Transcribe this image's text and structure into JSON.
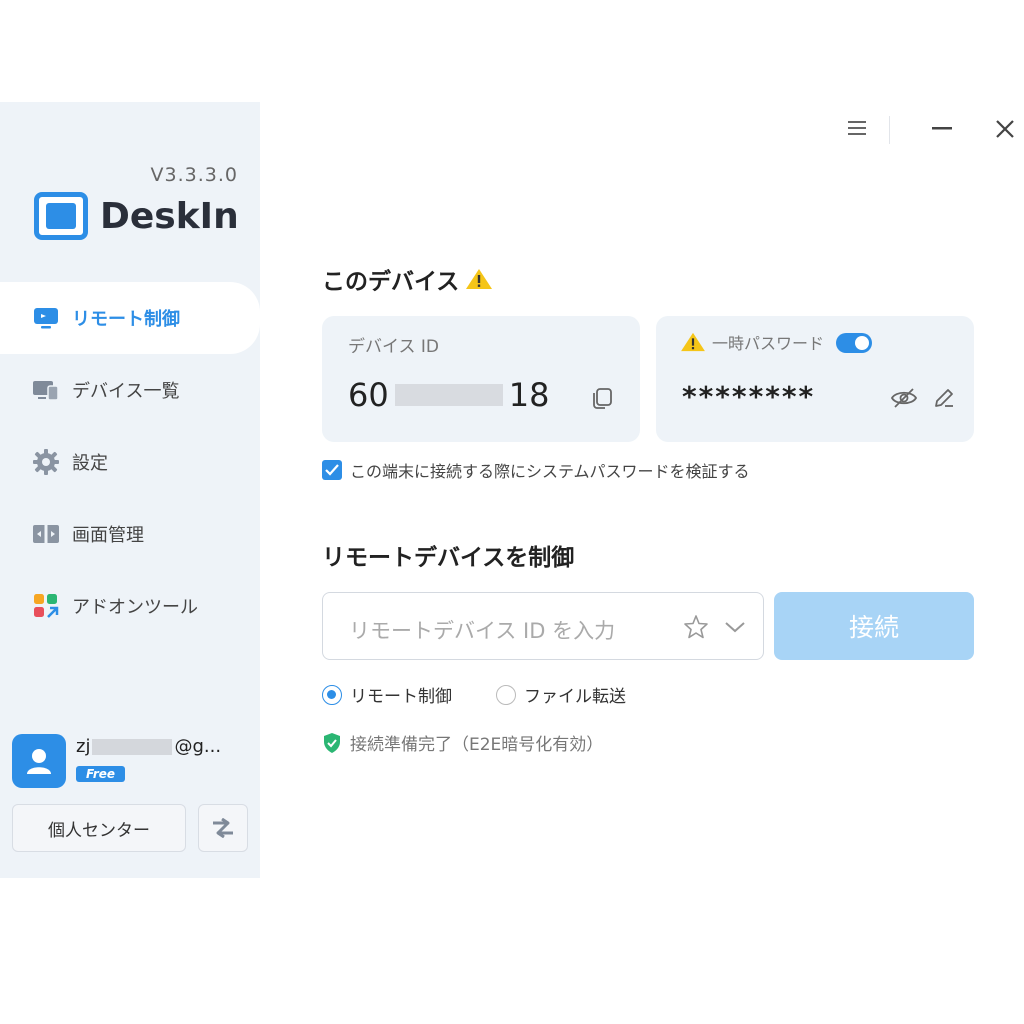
{
  "sidebar": {
    "version": "V3.3.3.0",
    "brand": "DeskIn",
    "items": [
      {
        "label": "リモート制御",
        "icon": "monitor-icon"
      },
      {
        "label": "デバイス一覧",
        "icon": "devices-icon"
      },
      {
        "label": "設定",
        "icon": "gear-icon"
      },
      {
        "label": "画面管理",
        "icon": "screen-manage-icon"
      },
      {
        "label": "アドオンツール",
        "icon": "addon-grid-icon"
      }
    ],
    "user": {
      "email_prefix": "zj",
      "email_suffix": "@g...",
      "plan": "Free"
    },
    "personal_center": "個人センター"
  },
  "main": {
    "this_device_title": "このデバイス",
    "device_id_label": "デバイス ID",
    "device_id_prefix": "60",
    "device_id_suffix": "18",
    "temp_password_label": "一時パスワード",
    "temp_password_value": "********",
    "verify_system_password": "この端末に接続する際にシステムパスワードを検証する",
    "remote_title": "リモートデバイスを制御",
    "remote_id_placeholder": "リモートデバイス ID を入力",
    "connect_label": "接続",
    "mode_remote": "リモート制御",
    "mode_file": "ファイル転送",
    "status": "接続準備完了（E2E暗号化有効）"
  },
  "colors": {
    "accent": "#2d8ee6",
    "sidebar_bg": "#eef3f8",
    "connect_disabled": "#a8d4f6",
    "warning": "#f5c518",
    "secure": "#2bb673"
  }
}
